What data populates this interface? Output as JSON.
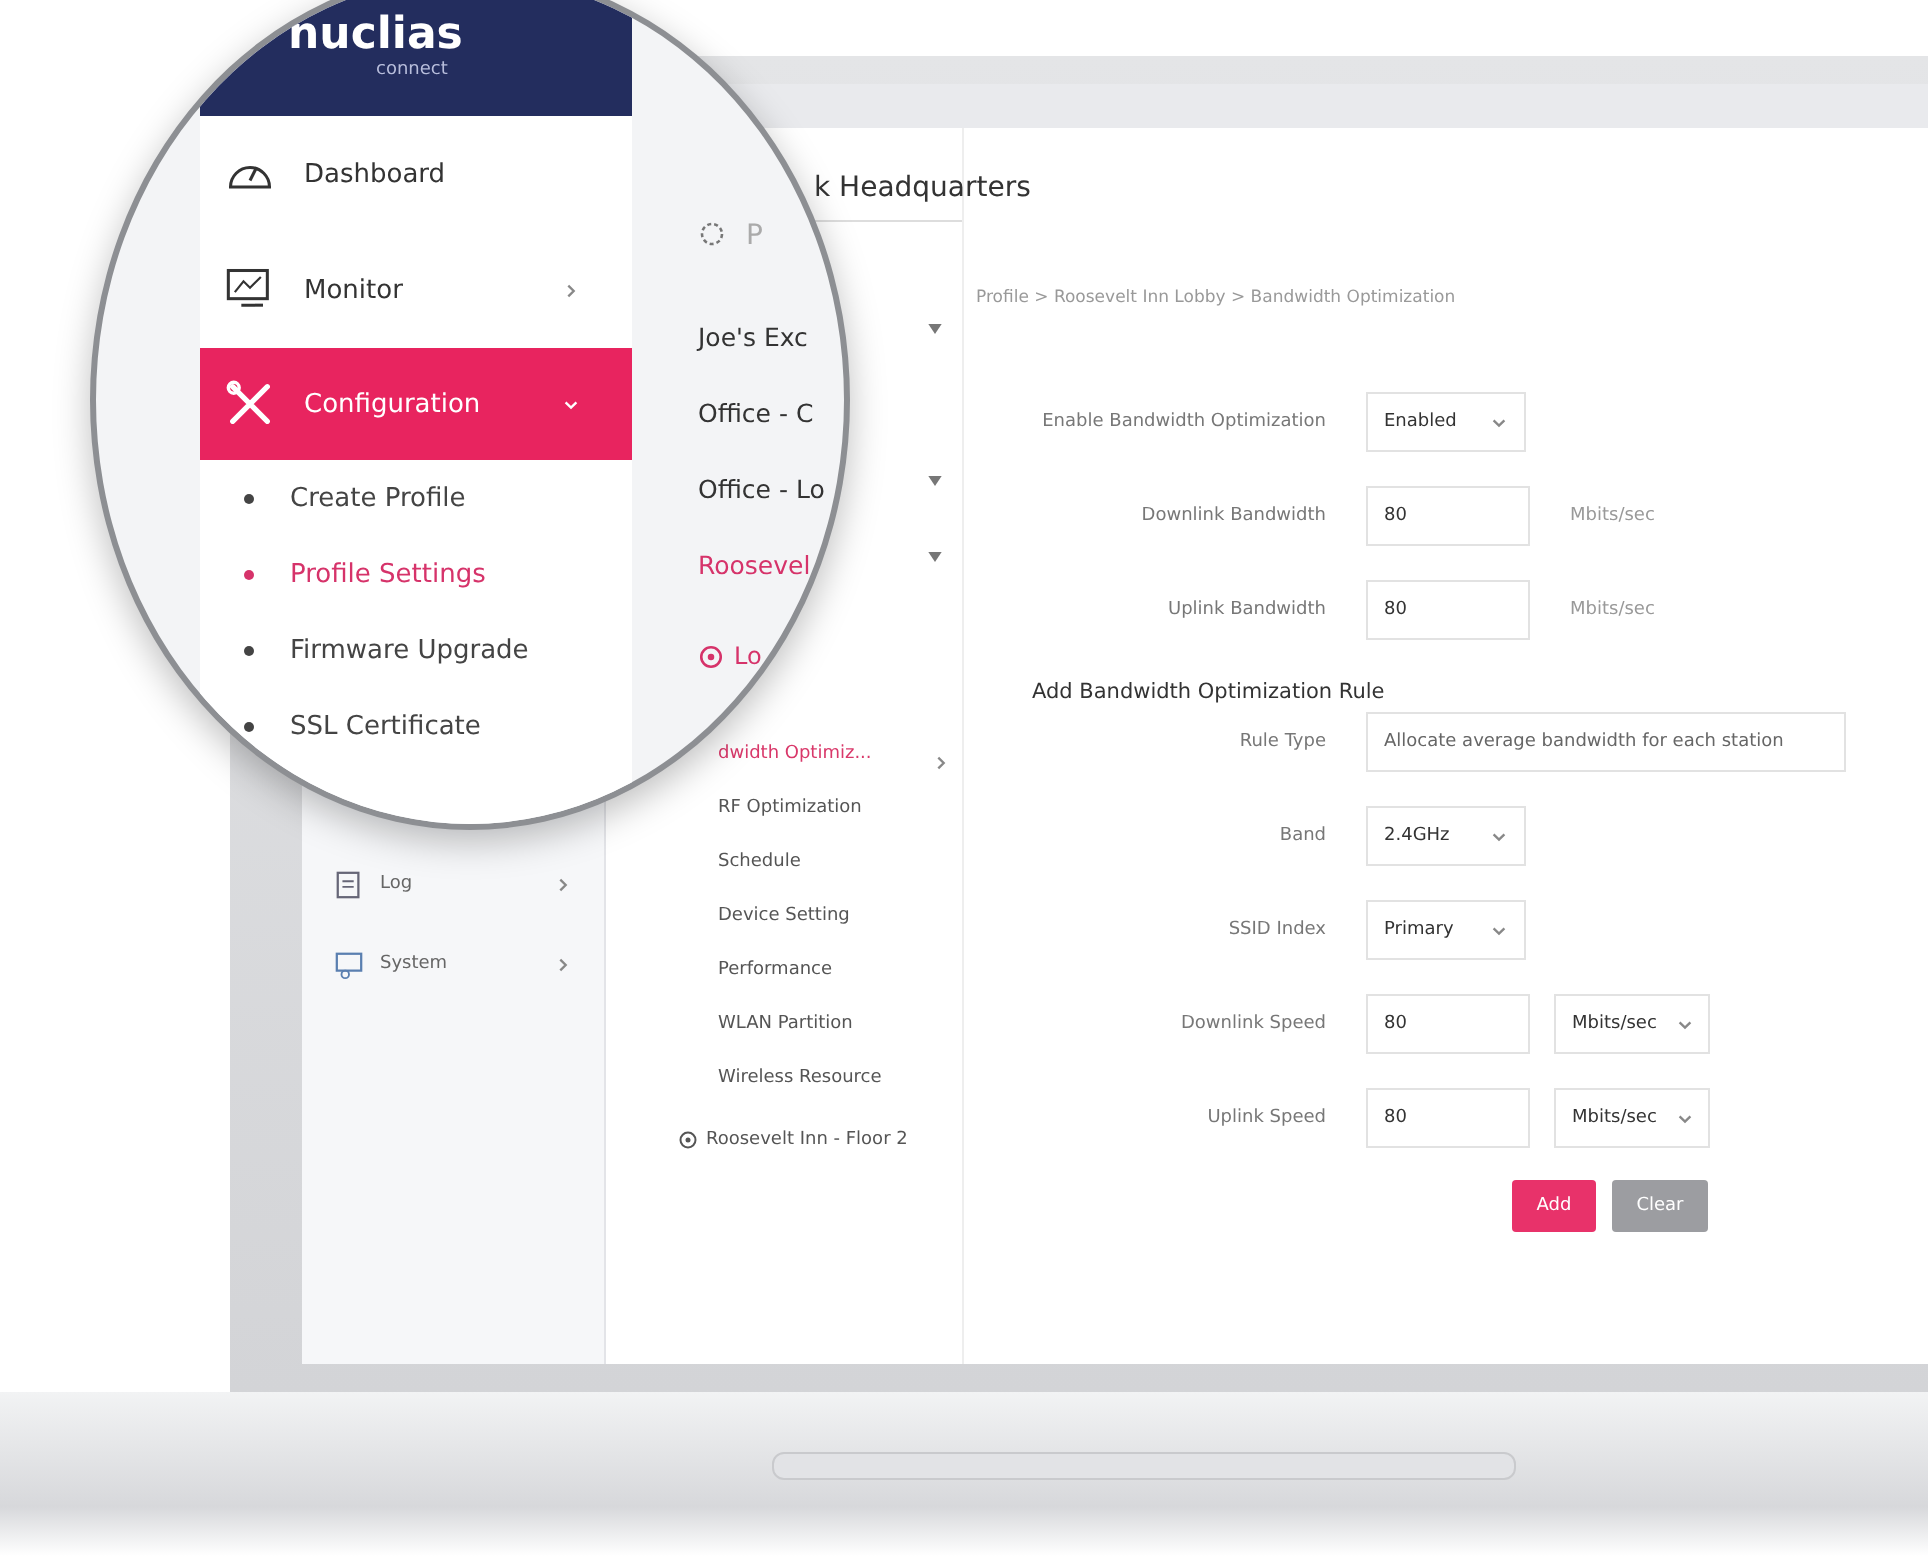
{
  "sidebar": {
    "logo": "nuclias",
    "logo_subtitle": "connect",
    "items": [
      {
        "label": "Dashboard",
        "kind": "plain",
        "selected": false
      },
      {
        "label": "Monitor",
        "kind": "submenu",
        "selected": false,
        "expanded": false
      },
      {
        "label": "Configuration",
        "kind": "submenu",
        "selected": true,
        "expanded": true,
        "children": [
          {
            "label": "Create Profile",
            "selected": false
          },
          {
            "label": "Profile Settings",
            "selected": true
          },
          {
            "label": "Firmware Upgrade",
            "selected": false
          },
          {
            "label": "SSL Certificate",
            "selected": false
          }
        ]
      }
    ],
    "lower_items": [
      {
        "label": "Log",
        "expanded": false
      },
      {
        "label": "System",
        "expanded": false
      }
    ]
  },
  "tree": {
    "title": "k Headquarters",
    "search": {
      "placeholder": "P"
    },
    "sites": [
      {
        "label": "Joe's Exc",
        "collapsible": true,
        "selected": false
      },
      {
        "label": "Office - C",
        "collapsible": false,
        "selected": false
      },
      {
        "label": "Office - Lo",
        "collapsible": true,
        "selected": false
      },
      {
        "label": "Roosevel",
        "collapsible": true,
        "selected": true
      }
    ],
    "location": {
      "label": "Lo",
      "selected": true
    },
    "settings": [
      {
        "label": "dwidth Optimiz...",
        "selected": true
      },
      {
        "label": "RF Optimization",
        "selected": false
      },
      {
        "label": "Schedule",
        "selected": false
      },
      {
        "label": "Device Setting",
        "selected": false
      },
      {
        "label": "Performance",
        "selected": false
      },
      {
        "label": "WLAN Partition",
        "selected": false
      },
      {
        "label": "Wireless Resource",
        "selected": false
      }
    ],
    "next_location": {
      "label": "Roosevelt Inn - Floor 2"
    }
  },
  "main": {
    "breadcrumb": "Profile > Roosevelt Inn Lobby > Bandwidth Optimization",
    "settings": [
      {
        "label": "Enable Bandwidth Optimization",
        "kind": "select",
        "value": "Enabled"
      },
      {
        "label": "Downlink Bandwidth",
        "kind": "input_unit",
        "value": "80",
        "unit": "Mbits/sec"
      },
      {
        "label": "Uplink Bandwidth",
        "kind": "input_unit",
        "value": "80",
        "unit": "Mbits/sec"
      }
    ],
    "rule_heading": "Add Bandwidth Optimization Rule",
    "rule": [
      {
        "label": "Rule Type",
        "kind": "wide",
        "value": "Allocate average bandwidth for each station"
      },
      {
        "label": "Band",
        "kind": "select",
        "value": "2.4GHz"
      },
      {
        "label": "SSID Index",
        "kind": "select",
        "value": "Primary"
      },
      {
        "label": "Downlink Speed",
        "kind": "input_select",
        "value": "80",
        "unit": "Mbits/sec"
      },
      {
        "label": "Uplink Speed",
        "kind": "input_select",
        "value": "80",
        "unit": "Mbits/sec"
      }
    ],
    "buttons": [
      {
        "label": "Add",
        "kind": "primary"
      },
      {
        "label": "Clear",
        "kind": "secondary"
      }
    ]
  }
}
